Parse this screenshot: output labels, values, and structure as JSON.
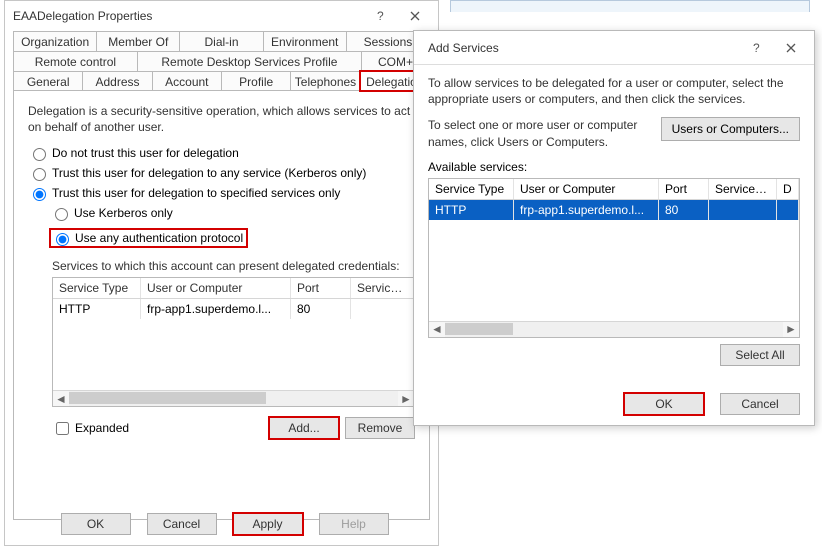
{
  "left_dialog": {
    "title": "EAADelegation Properties",
    "tabs_row1": [
      "Organization",
      "Member Of",
      "Dial-in",
      "Environment",
      "Sessions"
    ],
    "tabs_row2": [
      "Remote control",
      "Remote Desktop Services Profile",
      "COM+"
    ],
    "tabs_row3": [
      "General",
      "Address",
      "Account",
      "Profile",
      "Telephones",
      "Delegation"
    ],
    "active_tab": "Delegation",
    "intro": "Delegation is a security-sensitive operation, which allows services to act on behalf of another user.",
    "radio_no_trust": "Do not trust this user for delegation",
    "radio_any_service": "Trust this user for delegation to any service (Kerberos only)",
    "radio_specified": "Trust this user for delegation to specified services only",
    "radio_kerb_only": "Use Kerberos only",
    "radio_any_proto": "Use any authentication protocol",
    "svc_caption": "Services to which this account can present delegated credentials:",
    "svc_columns": {
      "st": "Service Type",
      "uc": "User or Computer",
      "pt": "Port",
      "sn": "Service N..."
    },
    "svc_rows": [
      {
        "st": "HTTP",
        "uc": "frp-app1.superdemo.l...",
        "pt": "80",
        "sn": ""
      }
    ],
    "expanded_label": "Expanded",
    "add_btn": "Add...",
    "remove_btn": "Remove",
    "footer": {
      "ok": "OK",
      "cancel": "Cancel",
      "apply": "Apply",
      "help": "Help"
    }
  },
  "right_dialog": {
    "title": "Add Services",
    "para1": "To allow services to be delegated for a user or computer, select the appropriate users or computers, and then click the services.",
    "para2": "To select one or more user or computer names, click Users or Computers.",
    "users_btn": "Users or Computers...",
    "avail_label": "Available services:",
    "columns": {
      "st": "Service Type",
      "uc": "User or Computer",
      "pt": "Port",
      "sn": "Service Name",
      "d": "D"
    },
    "rows": [
      {
        "st": "HTTP",
        "uc": "frp-app1.superdemo.l...",
        "pt": "80",
        "sn": "",
        "d": ""
      }
    ],
    "select_all": "Select All",
    "ok": "OK",
    "cancel": "Cancel"
  }
}
